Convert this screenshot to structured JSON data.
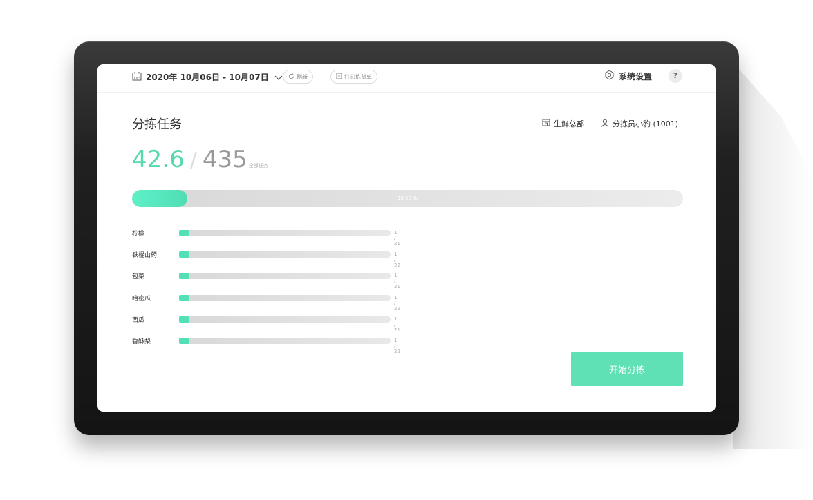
{
  "colors": {
    "accent": "#56d9b0",
    "button": "#5fe0b5",
    "track": "#dddddd",
    "device": "#1a1a1a"
  },
  "header": {
    "date_range": "2020年 10月06日 - 10月07日",
    "calendar_icon": "calendar-icon",
    "dropdown_icon": "chevron-down-icon",
    "refresh_label": "刷新",
    "print_label": "打印拣货单",
    "settings_label": "系统设置",
    "help_label": "?"
  },
  "page": {
    "title": "分拣任务",
    "store": "生鲜总部",
    "picker": "分拣员小豹 (1001)"
  },
  "summary": {
    "done": "42.6",
    "separator": "/",
    "total": "435",
    "total_caption": "全部任务",
    "progress_label": "10.00 %",
    "progress_fraction": 0.1
  },
  "items": [
    {
      "name": "柠檬",
      "count": "1 / 21",
      "fraction": 0.0476
    },
    {
      "name": "铁棍山药",
      "count": "1 / 22",
      "fraction": 0.0455
    },
    {
      "name": "包菜",
      "count": "1 / 21",
      "fraction": 0.0476
    },
    {
      "name": "哈密瓜",
      "count": "1 / 22",
      "fraction": 0.0455
    },
    {
      "name": "西瓜",
      "count": "1 / 21",
      "fraction": 0.0476
    },
    {
      "name": "香酥梨",
      "count": "1 / 22",
      "fraction": 0.0455
    }
  ],
  "actions": {
    "start_label": "开始分拣"
  }
}
